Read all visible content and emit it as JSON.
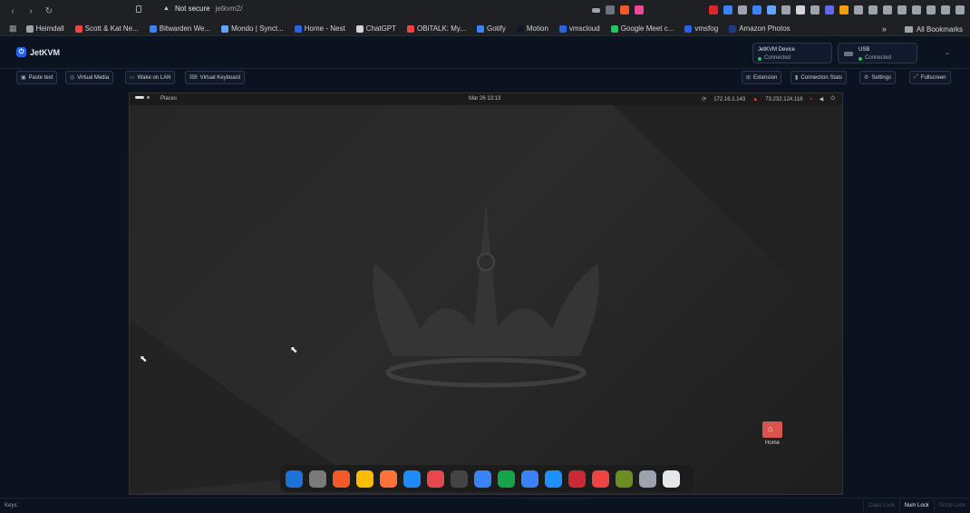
{
  "browser": {
    "nav": {
      "back": "‹",
      "forward": "›",
      "reload": "↻"
    },
    "security": "Not secure",
    "url": "jetkvm2/",
    "bookmarks": [
      {
        "label": "Heimdall",
        "color": "#9ca3af"
      },
      {
        "label": "Scott & Kat Ne...",
        "color": "#ef4444"
      },
      {
        "label": "Bitwarden We...",
        "color": "#3b82f6"
      },
      {
        "label": "Mondo | Synct...",
        "color": "#60a5fa"
      },
      {
        "label": "Home - Nest",
        "color": "#2563eb"
      },
      {
        "label": "ChatGPT",
        "color": "#d1d5db"
      },
      {
        "label": "OBiTALK: My...",
        "color": "#ef4444"
      },
      {
        "label": "Gotify",
        "color": "#3b82f6"
      },
      {
        "label": "Motion",
        "color": "#111827"
      },
      {
        "label": "vmscloud",
        "color": "#2563eb"
      },
      {
        "label": "Google Meet c...",
        "color": "#22c55e"
      },
      {
        "label": "vmsfog",
        "color": "#2563eb"
      },
      {
        "label": "Amazon Photos",
        "color": "#1e3a8a"
      }
    ],
    "overflow": "»",
    "all_bookmarks": "All Bookmarks"
  },
  "app": {
    "name": "JetKVM",
    "device": {
      "title": "JetKVM Device",
      "status": "Connected"
    },
    "usb": {
      "title": "USB",
      "status": "Connected"
    },
    "toolbar": {
      "paste_text": "Paste text",
      "virtual_media": "Virtual Media",
      "wake_on_lan": "Wake on LAN",
      "virtual_keyboard": "Virtual Keyboard",
      "extension": "Extension",
      "connection_stats": "Connection Stats",
      "settings": "Settings",
      "fullscreen": "Fullscreen"
    }
  },
  "remote": {
    "places": "Places",
    "clock": "Mar 26  13:13",
    "ip1": "172.16.1.143",
    "ip2": "73.232.124.118",
    "home_label": "Home",
    "dock_colors": [
      "#1d72d8",
      "#7a7a7a",
      "#f05a28",
      "#fbbc05",
      "#ff7139",
      "#1d8cf8",
      "#e5484d",
      "#444444",
      "#3b82f6",
      "#16a34a",
      "#3b82f6",
      "#1e90ff",
      "#cc2936",
      "#ef4444",
      "#6b8e23",
      "#9ca3af",
      "#e5e7eb"
    ]
  },
  "footer": {
    "keys_label": "Keys:",
    "caps_lock": "Caps Lock",
    "num_lock": "Num Lock",
    "scroll_lock": "Scroll Lock"
  },
  "colors": {
    "accent": "#2563eb",
    "connected": "#22c55e",
    "background": "#0b1220"
  }
}
